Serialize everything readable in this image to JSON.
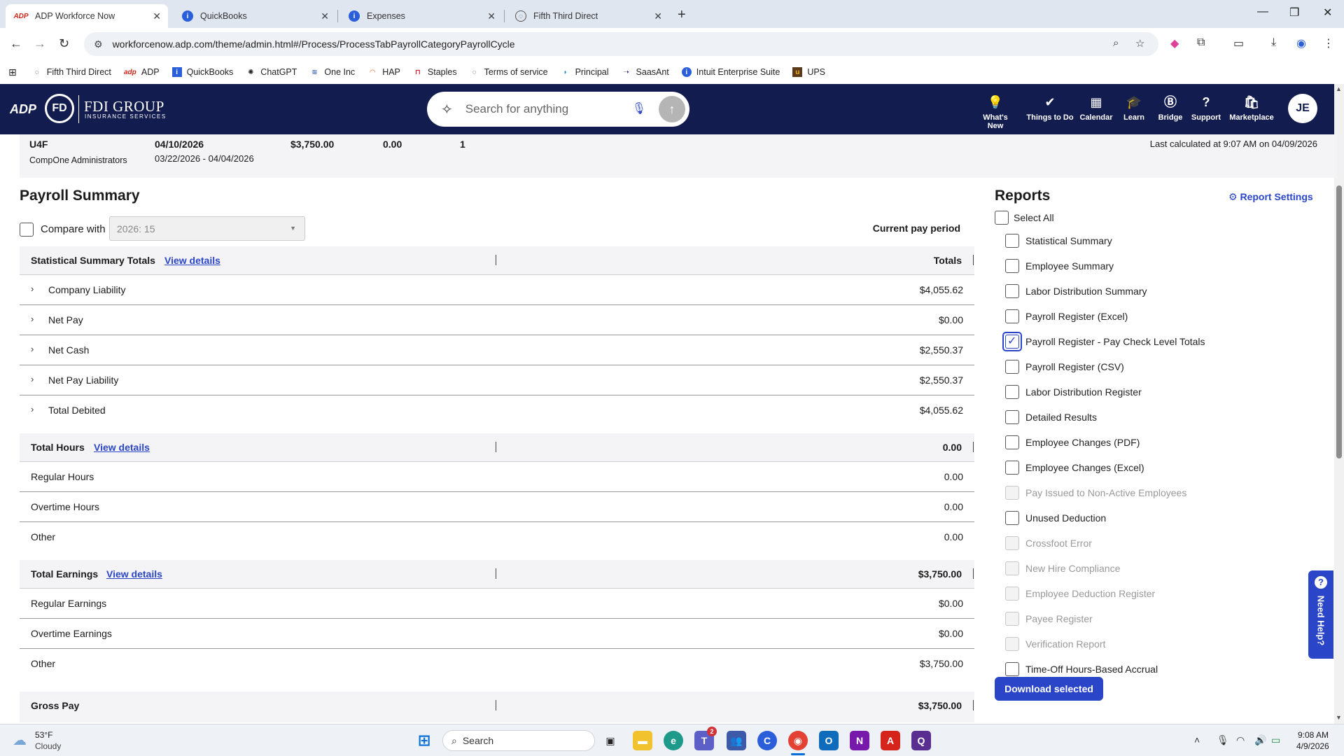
{
  "browser": {
    "tabs": [
      {
        "title": "ADP Workforce Now",
        "active": true
      },
      {
        "title": "QuickBooks",
        "active": false
      },
      {
        "title": "Expenses",
        "active": false
      },
      {
        "title": "Fifth Third Direct",
        "active": false
      }
    ],
    "url": "workforcenow.adp.com/theme/admin.html#/Process/ProcessTabPayrollCategoryPayrollCycle",
    "bookmarks": [
      "Fifth Third Direct",
      "ADP",
      "QuickBooks",
      "ChatGPT",
      "One Inc",
      "HAP",
      "Staples",
      "Terms of service",
      "Principal",
      "SaasAnt",
      "Intuit Enterprise Suite",
      "UPS"
    ]
  },
  "header": {
    "adp_logo": "ADP",
    "brand_mark": "FD",
    "brand_name": "FDI GROUP",
    "brand_sub": "INSURANCE SERVICES",
    "search_placeholder": "Search for anything",
    "nav": [
      "What's New",
      "Things to Do",
      "Calendar",
      "Learn",
      "Bridge",
      "Support",
      "Marketplace"
    ],
    "avatar": "JE"
  },
  "info": {
    "code": "U4F",
    "company": "CompOne Administrators",
    "check_date": "04/10/2026",
    "period": "03/22/2026 - 04/04/2026",
    "amount": "$3,750.00",
    "zero": "0.00",
    "count": "1",
    "calculated": "Last calculated at 9:07 AM on 04/09/2026"
  },
  "summary": {
    "title": "Payroll Summary",
    "compare_label": "Compare with",
    "compare_value": "2026: 15",
    "current_label": "Current pay period",
    "view_details": "View details",
    "stat_group": {
      "label": "Statistical Summary Totals",
      "value": "Totals"
    },
    "stat_rows": [
      {
        "label": "Company Liability",
        "value": "$4,055.62"
      },
      {
        "label": "Net Pay",
        "value": "$0.00"
      },
      {
        "label": "Net Cash",
        "value": "$2,550.37"
      },
      {
        "label": "Net Pay Liability",
        "value": "$2,550.37"
      },
      {
        "label": "Total Debited",
        "value": "$4,055.62"
      }
    ],
    "hours_group": {
      "label": "Total Hours",
      "value": "0.00"
    },
    "hours_rows": [
      {
        "label": "Regular Hours",
        "value": "0.00"
      },
      {
        "label": "Overtime Hours",
        "value": "0.00"
      },
      {
        "label": "Other",
        "value": "0.00"
      }
    ],
    "earn_group": {
      "label": "Total Earnings",
      "value": "$3,750.00"
    },
    "earn_rows": [
      {
        "label": "Regular Earnings",
        "value": "$0.00"
      },
      {
        "label": "Overtime Earnings",
        "value": "$0.00"
      },
      {
        "label": "Other",
        "value": "$3,750.00"
      }
    ],
    "gross_group": {
      "label": "Gross Pay",
      "value": "$3,750.00"
    }
  },
  "reports": {
    "title": "Reports",
    "settings": "Report Settings",
    "select_all": "Select All",
    "items": [
      {
        "label": "Statistical Summary",
        "checked": false,
        "disabled": false
      },
      {
        "label": "Employee Summary",
        "checked": false,
        "disabled": false
      },
      {
        "label": "Labor Distribution Summary",
        "checked": false,
        "disabled": false
      },
      {
        "label": "Payroll Register (Excel)",
        "checked": false,
        "disabled": false
      },
      {
        "label": "Payroll Register - Pay Check Level Totals",
        "checked": true,
        "disabled": false
      },
      {
        "label": "Payroll Register (CSV)",
        "checked": false,
        "disabled": false
      },
      {
        "label": "Labor Distribution Register",
        "checked": false,
        "disabled": false
      },
      {
        "label": "Detailed Results",
        "checked": false,
        "disabled": false
      },
      {
        "label": "Employee Changes (PDF)",
        "checked": false,
        "disabled": false
      },
      {
        "label": "Employee Changes (Excel)",
        "checked": false,
        "disabled": false
      },
      {
        "label": "Pay Issued to Non-Active Employees",
        "checked": false,
        "disabled": true
      },
      {
        "label": "Unused Deduction",
        "checked": false,
        "disabled": false
      },
      {
        "label": "Crossfoot Error",
        "checked": false,
        "disabled": true
      },
      {
        "label": "New Hire Compliance",
        "checked": false,
        "disabled": true
      },
      {
        "label": "Employee Deduction Register",
        "checked": false,
        "disabled": true
      },
      {
        "label": "Payee Register",
        "checked": false,
        "disabled": true
      },
      {
        "label": "Verification Report",
        "checked": false,
        "disabled": true
      },
      {
        "label": "Time-Off Hours-Based Accrual",
        "checked": false,
        "disabled": false
      }
    ],
    "download": "Download selected"
  },
  "need_help": "Need Help?",
  "taskbar": {
    "weather_temp": "53°F",
    "weather_desc": "Cloudy",
    "search": "Search",
    "teams_badge": "2",
    "time": "9:08 AM",
    "date": "4/9/2026"
  },
  "colors": {
    "adp_navy": "#121c4e",
    "accent_blue": "#2a45c8",
    "adp_red": "#d0271d"
  }
}
